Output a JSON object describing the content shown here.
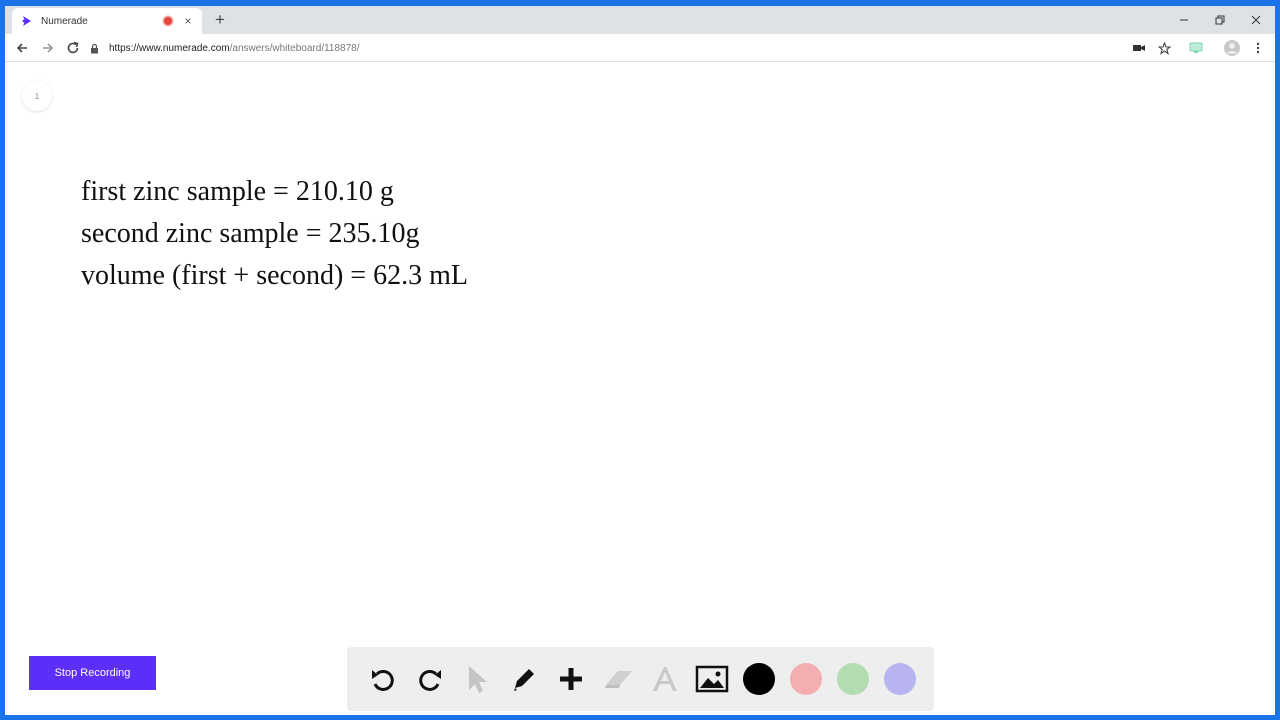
{
  "browser": {
    "tab_title": "Numerade",
    "url_host": "https://www.numerade.com",
    "url_path": "/answers/whiteboard/118878/",
    "new_tab_label": "+",
    "close_tab_label": "×"
  },
  "whiteboard": {
    "page_number": "1",
    "lines": [
      "first zinc sample = 210.10 g",
      "second zinc sample = 235.10g",
      "volume (first + second) = 62.3 mL"
    ]
  },
  "recording": {
    "stop_label": "Stop Recording",
    "button_color": "#5c2ef7"
  },
  "toolbar": {
    "tools": [
      "undo-icon",
      "redo-icon",
      "pointer-icon",
      "pen-icon",
      "add-icon",
      "eraser-icon",
      "text-icon",
      "image-icon"
    ],
    "colors": [
      "#000000",
      "#f4aeb1",
      "#b2dcb2",
      "#b8b4f2"
    ],
    "selected_color": "#000000"
  }
}
